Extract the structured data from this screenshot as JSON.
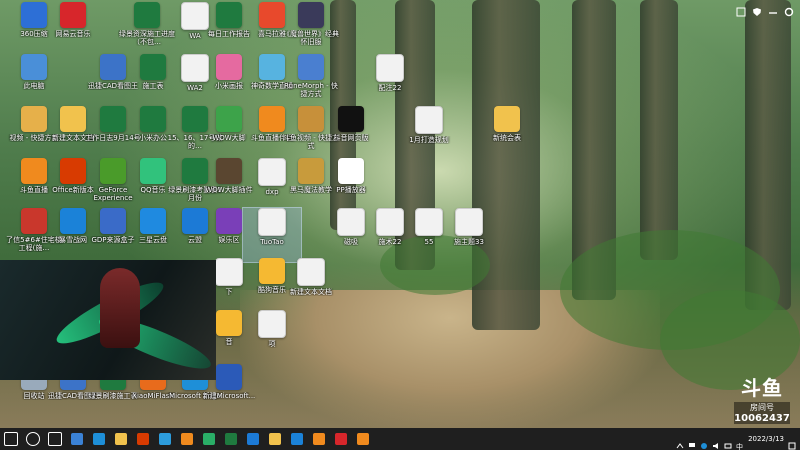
{
  "desktop_icons": [
    {
      "label": "360压缩",
      "icon": "archive-icon",
      "color": "#2d6fd6"
    },
    {
      "label": "网易云音乐",
      "icon": "netease-music-icon",
      "color": "#d7262b"
    },
    {
      "label": "绿景资深施工进度（不包…",
      "icon": "excel-icon",
      "color": "#1f7a3f"
    },
    {
      "label": "WA",
      "icon": "document-icon",
      "color": "#f2f2f2"
    },
    {
      "label": "每日工作报告",
      "icon": "excel-icon",
      "color": "#1f7a3f"
    },
    {
      "label": "喜马拉雅",
      "icon": "ximalaya-icon",
      "color": "#e8492c"
    },
    {
      "label": "《魔兽世界》经典怀旧服",
      "icon": "wow-icon",
      "color": "#3a3a5a"
    },
    {
      "label": "此电脑",
      "icon": "computer-icon",
      "color": "#4a8fd8"
    },
    {
      "label": "迅捷CAD看图王",
      "icon": "cad-viewer-icon",
      "color": "#3c73c8"
    },
    {
      "label": "施工表",
      "icon": "excel-icon",
      "color": "#1f7a3f"
    },
    {
      "label": "WA2",
      "icon": "document-icon",
      "color": "#f2f2f2"
    },
    {
      "label": "小米画报",
      "icon": "pinwheel-icon",
      "color": "#e56aa0"
    },
    {
      "label": "神奇数学直播",
      "icon": "character-icon",
      "color": "#57b3e0"
    },
    {
      "label": "RuneMorph - 快捷方式",
      "icon": "shortcut-icon",
      "color": "#4a7fd0"
    },
    {
      "label": "配注22",
      "icon": "document-icon",
      "color": "#f2f2f2"
    },
    {
      "label": "视频 - 快捷方式",
      "icon": "folder-shortcut-icon",
      "color": "#e6b04a"
    },
    {
      "label": "新建文本文档",
      "icon": "folder-icon",
      "color": "#f1c24d"
    },
    {
      "label": "工作日志9月14号",
      "icon": "excel-icon",
      "color": "#1f7a3f"
    },
    {
      "label": "小米办公",
      "icon": "excel-icon",
      "color": "#1f7a3f"
    },
    {
      "label": "15、16、17号做的…",
      "icon": "excel-icon",
      "color": "#1f7a3f"
    },
    {
      "label": "WOW大脚",
      "icon": "bigfoot-icon",
      "color": "#3da34a"
    },
    {
      "label": "斗鱼直播伴侣",
      "icon": "douyu-icon",
      "color": "#f08a1e"
    },
    {
      "label": "斗鱼视频 - 快捷方式",
      "icon": "video-shortcut-icon",
      "color": "#c7903a"
    },
    {
      "label": "抖音网页版",
      "icon": "tiktok-icon",
      "color": "#111111"
    },
    {
      "label": "1月打造规划",
      "icon": "document-icon",
      "color": "#f2f2f2"
    },
    {
      "label": "新统会表",
      "icon": "folder-icon",
      "color": "#f1c24d"
    },
    {
      "label": "斗鱼直播",
      "icon": "douyu-icon",
      "color": "#f08a1e"
    },
    {
      "label": "Office新版本",
      "icon": "pdf-icon",
      "color": "#d83b01"
    },
    {
      "label": "GeForce Experience",
      "icon": "nvidia-icon",
      "color": "#4a9b2a"
    },
    {
      "label": "QQ音乐",
      "icon": "qq-music-icon",
      "color": "#31c27c"
    },
    {
      "label": "绿景刷漆考勤表1月份",
      "icon": "excel-icon",
      "color": "#1f7a3f"
    },
    {
      "label": "WOW大脚插件",
      "icon": "bigfoot-icon",
      "color": "#5a4630"
    },
    {
      "label": "dxp",
      "icon": "document-icon",
      "color": "#f2f2f2"
    },
    {
      "label": "黑马魔法教学",
      "icon": "video-icon",
      "color": "#c89b3c"
    },
    {
      "label": "PP播放器",
      "icon": "player-icon",
      "color": "#ffffff"
    },
    {
      "label": "了信5#6#住宅楼工程(施…",
      "icon": "document-red-icon",
      "color": "#c9372c"
    },
    {
      "label": "暴雪战网",
      "icon": "battlenet-icon",
      "color": "#1b82d8"
    },
    {
      "label": "GDP来源盒子",
      "icon": "gdp-icon",
      "color": "#3a6bc8"
    },
    {
      "label": "三星云盘",
      "icon": "cloud-icon",
      "color": "#1f8ae0"
    },
    {
      "label": "云盟",
      "icon": "bird-icon",
      "color": "#1c7ad6"
    },
    {
      "label": "娱乐区",
      "icon": "w-logo-icon",
      "color": "#7a3fb8"
    },
    {
      "label": "TuoTao",
      "icon": "document-icon",
      "color": "#f2f2f2",
      "selected": true
    },
    {
      "label": "磁吸",
      "icon": "document-icon",
      "color": "#f2f2f2"
    },
    {
      "label": "施术22",
      "icon": "document-icon",
      "color": "#f2f2f2"
    },
    {
      "label": "55",
      "icon": "document-icon",
      "color": "#f2f2f2"
    },
    {
      "label": "施主题33",
      "icon": "document-icon",
      "color": "#f2f2f2"
    },
    {
      "label": "下",
      "icon": "document-icon",
      "color": "#f2f2f2"
    },
    {
      "label": "酷狗音乐",
      "icon": "kugou-icon",
      "color": "#f5b932"
    },
    {
      "label": "新建文本文档",
      "icon": "document-icon",
      "color": "#f2f2f2"
    },
    {
      "label": "音",
      "icon": "music-icon",
      "color": "#f5b932"
    },
    {
      "label": "项",
      "icon": "document-icon",
      "color": "#f2f2f2"
    },
    {
      "label": "回收站",
      "icon": "recycle-bin-icon",
      "color": "#9ab"
    },
    {
      "label": "迅捷CAD看图王",
      "icon": "cad-viewer-icon",
      "color": "#3c73c8"
    },
    {
      "label": "绿景刷漆施工表",
      "icon": "excel-icon",
      "color": "#1f7a3f"
    },
    {
      "label": "XiaoMiFlash",
      "icon": "flash-tool-icon",
      "color": "#e86b1c"
    },
    {
      "label": "Microsoft Edge",
      "icon": "edge-icon",
      "color": "#1e8fd8"
    },
    {
      "label": "新建Microsoft...",
      "icon": "word-icon",
      "color": "#2b5ab8"
    }
  ],
  "watermark": {
    "brand": "斗鱼",
    "room_label": "房间号",
    "room_id": "10062437"
  },
  "taskbar": {
    "apps": [
      {
        "icon": "start-icon",
        "color": "#ffffff"
      },
      {
        "icon": "search-icon",
        "color": "#ffffff"
      },
      {
        "icon": "task-view-icon",
        "color": "#ffffff"
      },
      {
        "icon": "mail-icon",
        "color": "#3b82d6"
      },
      {
        "icon": "edge-icon",
        "color": "#1e8fd8"
      },
      {
        "icon": "file-explorer-icon",
        "color": "#f1c24d"
      },
      {
        "icon": "office-icon",
        "color": "#d83b01"
      },
      {
        "icon": "360-browser-icon",
        "color": "#2d9cdb"
      },
      {
        "icon": "douyu-icon",
        "color": "#f08a1e"
      },
      {
        "icon": "wechat-icon",
        "color": "#2aae67"
      },
      {
        "icon": "excel-icon",
        "color": "#1f7a3f"
      },
      {
        "icon": "bird-icon",
        "color": "#1c7ad6"
      },
      {
        "icon": "folder-icon",
        "color": "#f1c24d"
      },
      {
        "icon": "battlenet-icon",
        "color": "#1b82d8"
      },
      {
        "icon": "douyu-icon",
        "color": "#f08a1e"
      },
      {
        "icon": "netease-music-icon",
        "color": "#d7262b"
      },
      {
        "icon": "douyu-live-icon",
        "color": "#f08a1e"
      }
    ],
    "clock_time": "",
    "clock_date": "2022/3/13"
  }
}
